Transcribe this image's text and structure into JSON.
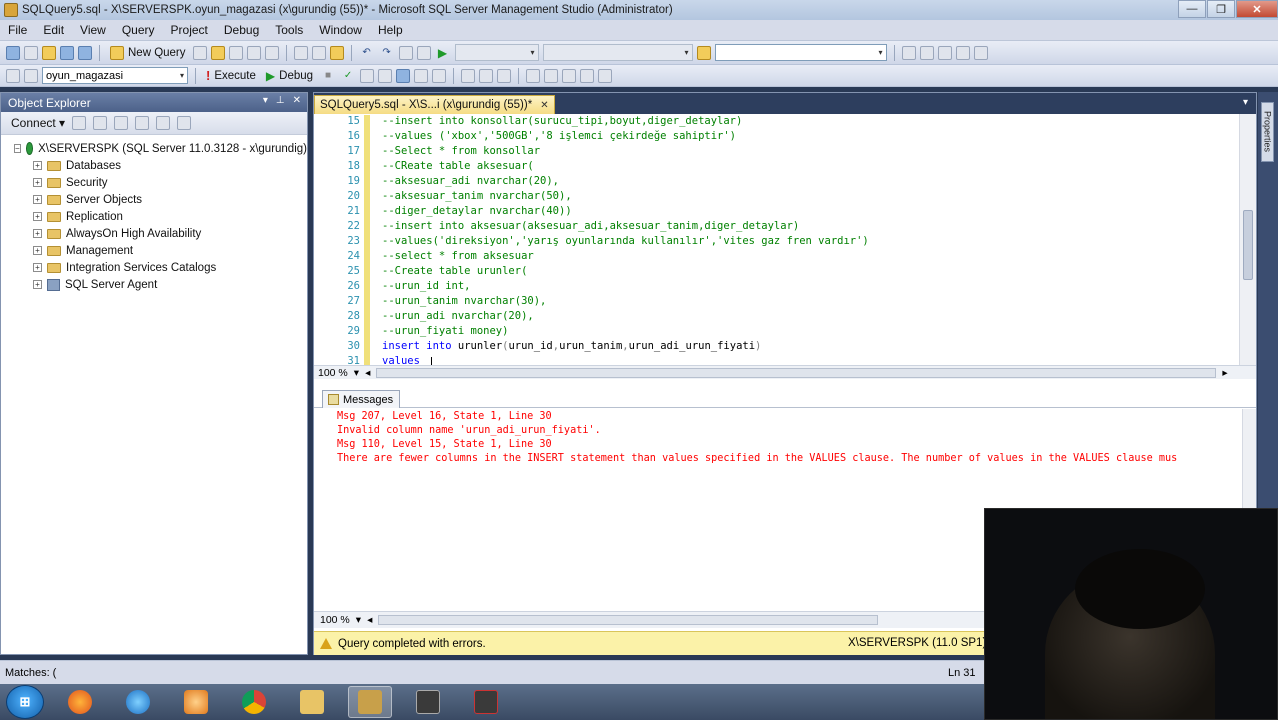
{
  "window": {
    "title": "SQLQuery5.sql - X\\SERVERSPK.oyun_magazasi (x\\gurundig (55))* - Microsoft SQL Server Management Studio (Administrator)",
    "minimize": "—",
    "maximize": "❐",
    "close": "✕"
  },
  "menu": [
    "File",
    "Edit",
    "View",
    "Query",
    "Project",
    "Debug",
    "Tools",
    "Window",
    "Help"
  ],
  "toolbar": {
    "new_query": "New Query",
    "database": "oyun_magazasi",
    "execute": "Execute",
    "debug": "Debug"
  },
  "object_explorer": {
    "title": "Object Explorer",
    "connect": "Connect",
    "server": "X\\SERVERSPK (SQL Server 11.0.3128 - x\\gurundig)",
    "nodes": [
      "Databases",
      "Security",
      "Server Objects",
      "Replication",
      "AlwaysOn High Availability",
      "Management",
      "Integration Services Catalogs",
      "SQL Server Agent"
    ]
  },
  "document": {
    "tab_label": "SQLQuery5.sql - X\\S...i (x\\gurundig (55))*",
    "zoom": "100 %",
    "lines": [
      {
        "n": "15",
        "parts": [
          {
            "t": "--insert into konsollar(surucu_tipi,boyut,diger_detaylar)",
            "c": "c-comment"
          }
        ]
      },
      {
        "n": "16",
        "parts": [
          {
            "t": "--values ('xbox','500GB','8 işlemci çekirdeğe sahiptir')",
            "c": "c-comment"
          }
        ]
      },
      {
        "n": "17",
        "parts": [
          {
            "t": "--Select * from konsollar",
            "c": "c-comment"
          }
        ]
      },
      {
        "n": "18",
        "parts": [
          {
            "t": "--CReate table aksesuar(",
            "c": "c-comment"
          }
        ]
      },
      {
        "n": "19",
        "parts": [
          {
            "t": "--aksesuar_adi nvarchar(20),",
            "c": "c-comment"
          }
        ]
      },
      {
        "n": "20",
        "parts": [
          {
            "t": "--aksesuar_tanim nvarchar(50),",
            "c": "c-comment"
          }
        ]
      },
      {
        "n": "21",
        "parts": [
          {
            "t": "--diger_detaylar nvarchar(40))",
            "c": "c-comment"
          }
        ]
      },
      {
        "n": "22",
        "parts": [
          {
            "t": "--insert into aksesuar(aksesuar_adi,aksesuar_tanim,diger_detaylar)",
            "c": "c-comment"
          }
        ]
      },
      {
        "n": "23",
        "parts": [
          {
            "t": "--values('direksiyon','yarış oyunlarında kullanılır','vites gaz fren vardır')",
            "c": "c-comment"
          }
        ]
      },
      {
        "n": "24",
        "parts": [
          {
            "t": "--select * from aksesuar",
            "c": "c-comment"
          }
        ]
      },
      {
        "n": "25",
        "parts": [
          {
            "t": "--Create table urunler(",
            "c": "c-comment"
          }
        ]
      },
      {
        "n": "26",
        "parts": [
          {
            "t": "--urun_id int,",
            "c": "c-comment"
          }
        ]
      },
      {
        "n": "27",
        "parts": [
          {
            "t": "--urun_tanim nvarchar(30),",
            "c": "c-comment"
          }
        ]
      },
      {
        "n": "28",
        "parts": [
          {
            "t": "--urun_adi nvarchar(20),",
            "c": "c-comment"
          }
        ]
      },
      {
        "n": "29",
        "parts": [
          {
            "t": "--urun_fiyati money)",
            "c": "c-comment"
          }
        ]
      },
      {
        "n": "30",
        "parts": [
          {
            "t": "insert",
            "c": "c-kw"
          },
          {
            "t": " ",
            "c": "c-plain"
          },
          {
            "t": "into",
            "c": "c-kw"
          },
          {
            "t": " urunler",
            "c": "c-plain"
          },
          {
            "t": "(",
            "c": "c-fn"
          },
          {
            "t": "urun_id",
            "c": "c-plain"
          },
          {
            "t": ",",
            "c": "c-fn"
          },
          {
            "t": "urun_tanim",
            "c": "c-plain"
          },
          {
            "t": ",",
            "c": "c-fn"
          },
          {
            "t": "urun_adi_urun_fiyati",
            "c": "c-plain"
          },
          {
            "t": ")",
            "c": "c-fn"
          }
        ]
      },
      {
        "n": "31",
        "parts": [
          {
            "t": "values",
            "c": "c-kw"
          },
          {
            "t": " ",
            "c": "c-plain"
          }
        ]
      }
    ]
  },
  "messages": {
    "tab_label": "Messages",
    "lines": [
      "Msg 207, Level 16, State 1, Line 30",
      "Invalid column name 'urun_adi_urun_fiyati'.",
      "Msg 110, Level 15, State 1, Line 30",
      "There are fewer columns in the INSERT statement than values specified in the VALUES clause. The number of values in the VALUES clause mus"
    ],
    "zoom": "100 %"
  },
  "query_status": {
    "text": "Query completed with errors.",
    "server": "X\\SERVERSPK (11.0 SP1)"
  },
  "statusbar": {
    "matches": "Matches: (",
    "line": "Ln 31"
  },
  "side_panel": "Properties"
}
